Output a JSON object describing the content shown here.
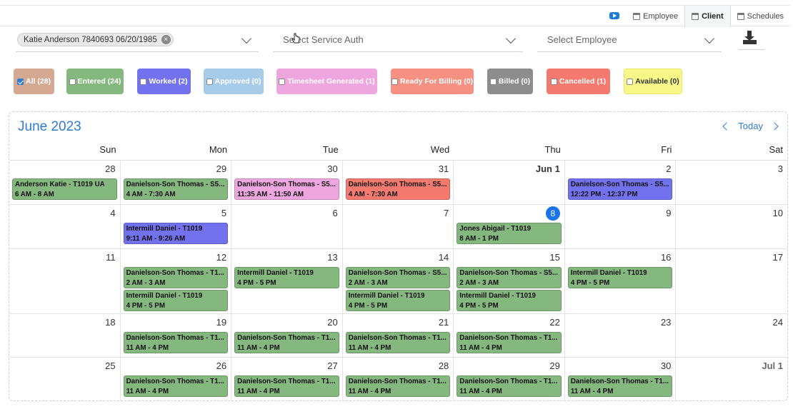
{
  "tabs": [
    {
      "label": "Employee",
      "icon": "calendar-icon",
      "active": false
    },
    {
      "label": "Client",
      "icon": "calendar-icon",
      "active": true
    },
    {
      "label": "Schedules",
      "icon": "calendar-icon",
      "active": false
    }
  ],
  "filters": {
    "client_chip": "Katie Anderson 7840693 06/20/1985",
    "chip_remove": "×",
    "service_auth_placeholder": "Select Service Auth",
    "employee_placeholder": "Select Employee"
  },
  "statuses": [
    {
      "label": "All (28)",
      "color": "#d4a891",
      "checked": true
    },
    {
      "label": "Entered (24)",
      "color": "#85b87f",
      "checked": false
    },
    {
      "label": "Worked (2)",
      "color": "#7272ee",
      "checked": false
    },
    {
      "label": "Approved (0)",
      "color": "#a7cce9",
      "checked": false
    },
    {
      "label": "Timesheet Generated (1)",
      "color": "#eea6df",
      "checked": false
    },
    {
      "label": "Ready For Billing (0)",
      "color": "#f59082",
      "checked": false
    },
    {
      "label": "Billed (0)",
      "color": "#8d8d8d",
      "checked": false
    },
    {
      "label": "Cancelled (1)",
      "color": "#f47a70",
      "checked": false
    },
    {
      "label": "Available (0)",
      "color": "#f8f889",
      "checked": false
    }
  ],
  "calendar": {
    "month": "June",
    "year": "2023",
    "today_label": "Today",
    "weekdays": [
      "Sun",
      "Mon",
      "Tue",
      "Wed",
      "Thu",
      "Fri",
      "Sat"
    ],
    "days": [
      {
        "n": "28"
      },
      {
        "n": "29"
      },
      {
        "n": "30"
      },
      {
        "n": "31"
      },
      {
        "n": "Jun  1",
        "bold": true
      },
      {
        "n": "2"
      },
      {
        "n": "3"
      },
      {
        "n": "4"
      },
      {
        "n": "5"
      },
      {
        "n": "6"
      },
      {
        "n": "7"
      },
      {
        "n": "8",
        "today": true
      },
      {
        "n": "9"
      },
      {
        "n": "10"
      },
      {
        "n": "11"
      },
      {
        "n": "12"
      },
      {
        "n": "13"
      },
      {
        "n": "14"
      },
      {
        "n": "15"
      },
      {
        "n": "16"
      },
      {
        "n": "17"
      },
      {
        "n": "18"
      },
      {
        "n": "19"
      },
      {
        "n": "20"
      },
      {
        "n": "21"
      },
      {
        "n": "22"
      },
      {
        "n": "23"
      },
      {
        "n": "24"
      },
      {
        "n": "25"
      },
      {
        "n": "26"
      },
      {
        "n": "27"
      },
      {
        "n": "28"
      },
      {
        "n": "29"
      },
      {
        "n": "30"
      },
      {
        "n": "Jul  1",
        "muted": true
      }
    ],
    "events": [
      {
        "day": 0,
        "title": "Anderson Katie - T1019 UA",
        "time": "6 AM - 8 AM",
        "color": "#85b87f"
      },
      {
        "day": 1,
        "title": "Danielson-Son Thomas - S5...",
        "time": "4 AM - 7:30 AM",
        "color": "#85b87f"
      },
      {
        "day": 2,
        "title": "Danielson-Son Thomas - S5...",
        "time": "11:35 AM - 11:50 AM",
        "color": "#eea6df"
      },
      {
        "day": 3,
        "title": "Danielson-Son Thomas - S5...",
        "time": "4 AM - 7:30 AM",
        "color": "#f47a70"
      },
      {
        "day": 5,
        "title": "Danielson-Son Thomas - S5...",
        "time": "12:22 PM - 12:37 PM",
        "color": "#7272ee"
      },
      {
        "day": 8,
        "title": "Intermill Daniel - T1019",
        "time": "9:11 AM - 9:26 AM",
        "color": "#7272ee"
      },
      {
        "day": 11,
        "title": "Jones Abigail - T1019",
        "time": "8 AM - 1 PM",
        "color": "#85b87f"
      },
      {
        "day": 15,
        "title": "Danielson-Son Thomas - T1...",
        "time": "2 AM - 3 AM",
        "color": "#85b87f"
      },
      {
        "day": 15,
        "title": "Intermill Daniel - T1019",
        "time": "4 PM - 5 PM",
        "color": "#85b87f"
      },
      {
        "day": 16,
        "title": "Intermill Daniel - T1019",
        "time": "4 PM - 5 PM",
        "color": "#85b87f"
      },
      {
        "day": 17,
        "title": "Danielson-Son Thomas - S5...",
        "time": "2 AM - 3 AM",
        "color": "#85b87f"
      },
      {
        "day": 17,
        "title": "Intermill Daniel - T1019",
        "time": "4 PM - 5 PM",
        "color": "#85b87f"
      },
      {
        "day": 18,
        "title": "Danielson-Son Thomas - S5...",
        "time": "2 AM - 3 AM",
        "color": "#85b87f"
      },
      {
        "day": 18,
        "title": "Intermill Daniel - T1019",
        "time": "4 PM - 5 PM",
        "color": "#85b87f"
      },
      {
        "day": 19,
        "title": "Intermill Daniel - T1019",
        "time": "4 PM - 5 PM",
        "color": "#85b87f"
      },
      {
        "day": 22,
        "title": "Danielson-Son Thomas - T1...",
        "time": "11 AM - 4 PM",
        "color": "#85b87f"
      },
      {
        "day": 23,
        "title": "Danielson-Son Thomas - T1...",
        "time": "11 AM - 4 PM",
        "color": "#85b87f"
      },
      {
        "day": 24,
        "title": "Danielson-Son Thomas - T1...",
        "time": "11 AM - 4 PM",
        "color": "#85b87f"
      },
      {
        "day": 25,
        "title": "Danielson-Son Thomas - T1...",
        "time": "11 AM - 4 PM",
        "color": "#85b87f"
      },
      {
        "day": 29,
        "title": "Danielson-Son Thomas - T1...",
        "time": "11 AM - 4 PM",
        "color": "#85b87f"
      },
      {
        "day": 30,
        "title": "Danielson-Son Thomas - T1...",
        "time": "11 AM - 4 PM",
        "color": "#85b87f"
      },
      {
        "day": 31,
        "title": "Danielson-Son Thomas - T1...",
        "time": "11 AM - 4 PM",
        "color": "#85b87f"
      },
      {
        "day": 32,
        "title": "Danielson-Son Thomas - T1...",
        "time": "11 AM - 4 PM",
        "color": "#85b87f"
      },
      {
        "day": 33,
        "title": "Danielson-Son Thomas - T1...",
        "time": "11 AM - 4 PM",
        "color": "#85b87f"
      }
    ]
  }
}
